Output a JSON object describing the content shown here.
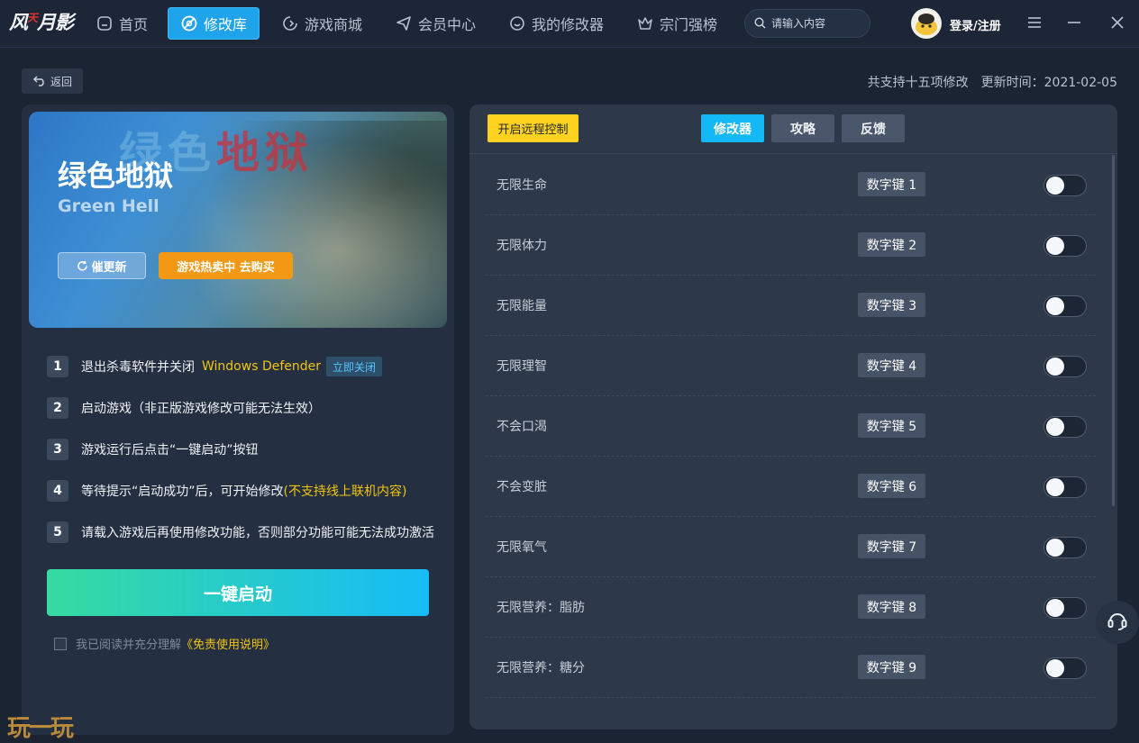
{
  "app": {
    "logo_text": "风",
    "logo_text2": "月影",
    "logo_accent": "天"
  },
  "nav": {
    "items": [
      {
        "label": "首页",
        "icon": "home-icon"
      },
      {
        "label": "修改库",
        "icon": "trainer-library-icon",
        "active": true
      },
      {
        "label": "游戏商城",
        "icon": "store-icon"
      },
      {
        "label": "会员中心",
        "icon": "member-icon"
      },
      {
        "label": "我的修改器",
        "icon": "my-trainer-icon"
      },
      {
        "label": "宗门强榜",
        "icon": "crown-icon"
      }
    ],
    "search_placeholder": "请输入内容",
    "login_label": "登录/注册"
  },
  "subheader": {
    "back_label": "返回",
    "support_count": "共支持十五项修改",
    "update_time": "更新时间：2021-02-05"
  },
  "game": {
    "title_cn": "绿色地狱",
    "title_en": "Green Hell",
    "cover_logo_a": "绿色",
    "cover_logo_b": "地狱",
    "update_btn": "催更新",
    "buy_btn": "游戏热卖中 去购买"
  },
  "steps": [
    {
      "num": "1",
      "text": "退出杀毒软件并关闭",
      "highlight": "Windows Defender",
      "action": "立即关闭"
    },
    {
      "num": "2",
      "text": "启动游戏（非正版游戏修改可能无法生效）"
    },
    {
      "num": "3",
      "text": "游戏运行后点击“一键启动”按钮"
    },
    {
      "num": "4",
      "text": "等待提示“启动成功”后，可开始修改",
      "highlight": "(不支持线上联机内容)"
    },
    {
      "num": "5",
      "text": "请载入游戏后再使用修改功能，否则部分功能可能无法成功激活"
    }
  ],
  "start_button": "一键启动",
  "agreement": {
    "text": "我已阅读并充分理解",
    "link": "《免责使用说明》"
  },
  "right": {
    "remote_btn": "开启远程控制",
    "tabs": [
      "修改器",
      "攻略",
      "反馈"
    ],
    "active_tab": 0,
    "cheats": [
      {
        "name": "无限生命",
        "key": "数字键 1",
        "enabled": false
      },
      {
        "name": "无限体力",
        "key": "数字键 2",
        "enabled": false
      },
      {
        "name": "无限能量",
        "key": "数字键 3",
        "enabled": false
      },
      {
        "name": "无限理智",
        "key": "数字键 4",
        "enabled": false
      },
      {
        "name": "不会口渴",
        "key": "数字键 5",
        "enabled": false
      },
      {
        "name": "不会变脏",
        "key": "数字键 6",
        "enabled": false
      },
      {
        "name": "无限氧气",
        "key": "数字键 7",
        "enabled": false
      },
      {
        "name": "无限营养：脂肪",
        "key": "数字键 8",
        "enabled": false
      },
      {
        "name": "无限营养：糖分",
        "key": "数字键 9",
        "enabled": false
      }
    ]
  },
  "watermark": "玩一玩",
  "colors": {
    "accent": "#1fa3ea",
    "yellow": "#f1c40f",
    "buy_orange": "#f39814",
    "remote_yellow": "#ffd21f"
  }
}
